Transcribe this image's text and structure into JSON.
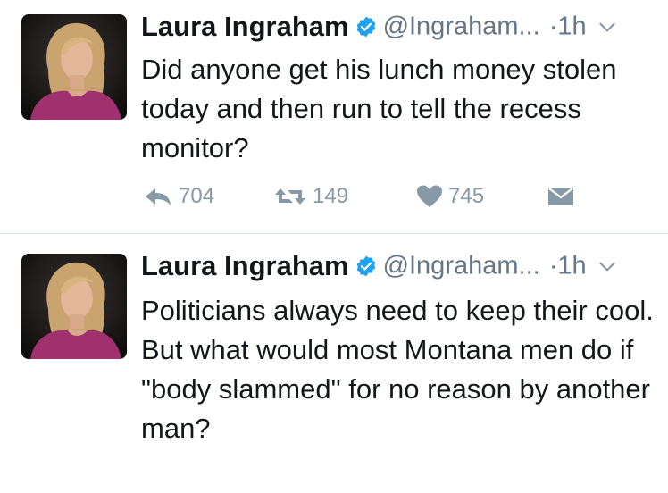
{
  "tweets": [
    {
      "author_name": "Laura Ingraham",
      "handle": "@Ingraham...",
      "dot": "·",
      "time": "1h",
      "text": "Did anyone get his lunch money stolen today and then run to tell the recess monitor?",
      "replies": "704",
      "retweets": "149",
      "likes": "745",
      "icons": [
        "verified-badge-icon",
        "chevron-down-icon",
        "reply-icon",
        "retweet-icon",
        "heart-icon",
        "direct-message-icon"
      ]
    },
    {
      "author_name": "Laura Ingraham",
      "handle": "@Ingraham...",
      "dot": "·",
      "time": "1h",
      "text": "Politicians always need to keep their cool. But what would most Montana men do if \"body slammed\" for no reason by another man?",
      "icons": [
        "verified-badge-icon",
        "chevron-down-icon"
      ]
    }
  ],
  "colors": {
    "verified": "#1da1f2",
    "secondary_text": "#657786",
    "action_icons": "#8899a6",
    "divider": "#e1e8ed"
  }
}
